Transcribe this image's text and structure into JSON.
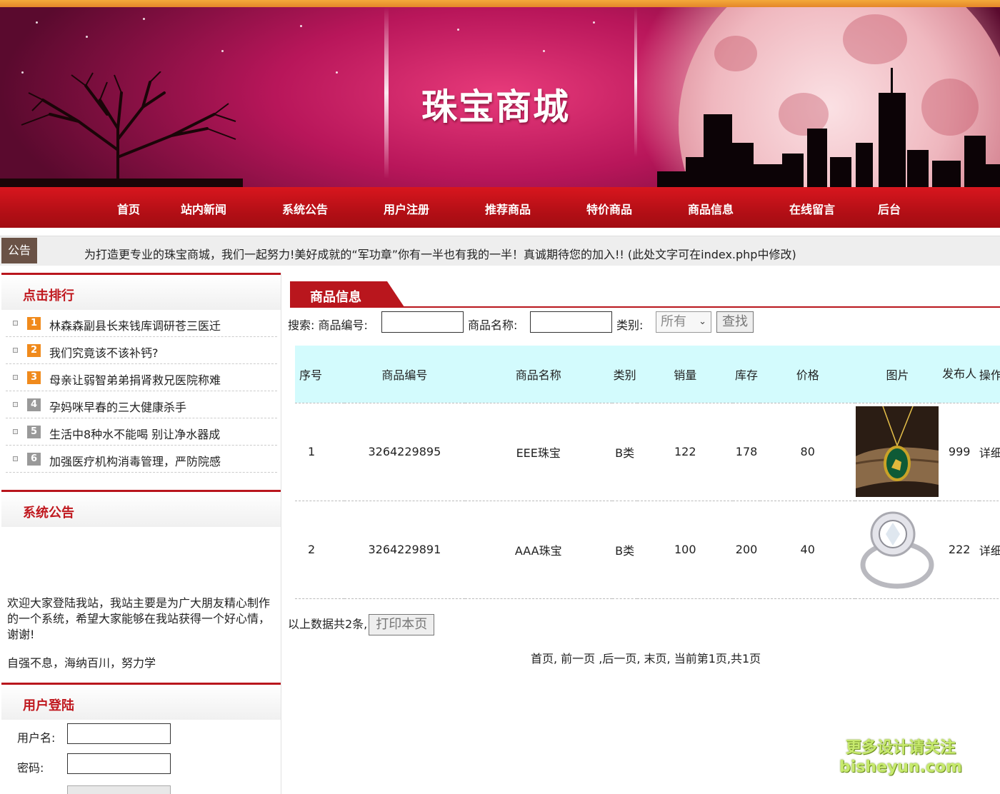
{
  "site": {
    "title": "珠宝商城"
  },
  "colors": {
    "brand_red": "#b9161d",
    "header_row": "#d3fbfd",
    "notice_tag": "#6a5246"
  },
  "nav": [
    {
      "label": "首页"
    },
    {
      "label": "站内新闻"
    },
    {
      "label": "系统公告"
    },
    {
      "label": "用户注册"
    },
    {
      "label": "推荐商品"
    },
    {
      "label": "特价商品"
    },
    {
      "label": "商品信息"
    },
    {
      "label": "在线留言"
    },
    {
      "label": "后台"
    }
  ],
  "notice": {
    "tag": "公告",
    "text": "为打造更专业的珠宝商城，我们一起努力!美好成就的“军功章”你有一半也有我的一半！真诚期待您的加入!! (此处文字可在index.php中修改)"
  },
  "ranking": {
    "title": "点击排行",
    "items": [
      {
        "num": "1",
        "color": "#f08a1c",
        "text": "林森森副县长来钱库调研苍三医迁"
      },
      {
        "num": "2",
        "color": "#f08a1c",
        "text": "我们究竟该不该补钙?"
      },
      {
        "num": "3",
        "color": "#f08a1c",
        "text": "母亲让弱智弟弟捐肾救兄医院称难"
      },
      {
        "num": "4",
        "color": "#999999",
        "text": "孕妈咪早春的三大健康杀手"
      },
      {
        "num": "5",
        "color": "#999999",
        "text": "生活中8种水不能喝 别让净水器成"
      },
      {
        "num": "6",
        "color": "#999999",
        "text": "加强医疗机构消毒管理，严防院感"
      }
    ]
  },
  "announcement": {
    "title": "系统公告",
    "p1": "欢迎大家登陆我站，我站主要是为广大朋友精心制作的一个系统，希望大家能够在我站获得一个好心情，谢谢!",
    "p2": "自强不息，海纳百川，努力学"
  },
  "login": {
    "title": "用户登陆",
    "username_label": "用户名:",
    "password_label": "密码:"
  },
  "goods": {
    "tab_title": "商品信息",
    "search": {
      "label": "搜索: 商品编号:",
      "name_label": "商品名称:",
      "category_label": "类别:",
      "category_value": "所有",
      "button": "查找"
    },
    "columns": [
      "序号",
      "商品编号",
      "商品名称",
      "类别",
      "销量",
      "库存",
      "价格",
      "图片",
      "发布人",
      "操作"
    ],
    "rows": [
      {
        "index": "1",
        "code": "3264229895",
        "name": "EEE珠宝",
        "category": "B类",
        "sales": "122",
        "stock": "178",
        "price": "80",
        "image_icon": "pendant-image",
        "publisher": "999",
        "op": "详细"
      },
      {
        "index": "2",
        "code": "3264229891",
        "name": "AAA珠宝",
        "category": "B类",
        "sales": "100",
        "stock": "200",
        "price": "40",
        "image_icon": "ring-image",
        "publisher": "222",
        "op": "详细"
      }
    ],
    "count_text": "以上数据共2条,",
    "print_button": "打印本页",
    "pager": "首页, 前一页 ,后一页, 末页, 当前第1页,共1页"
  },
  "watermark": {
    "line1": "更多设计请关注",
    "line2": "bisheyun.com"
  }
}
